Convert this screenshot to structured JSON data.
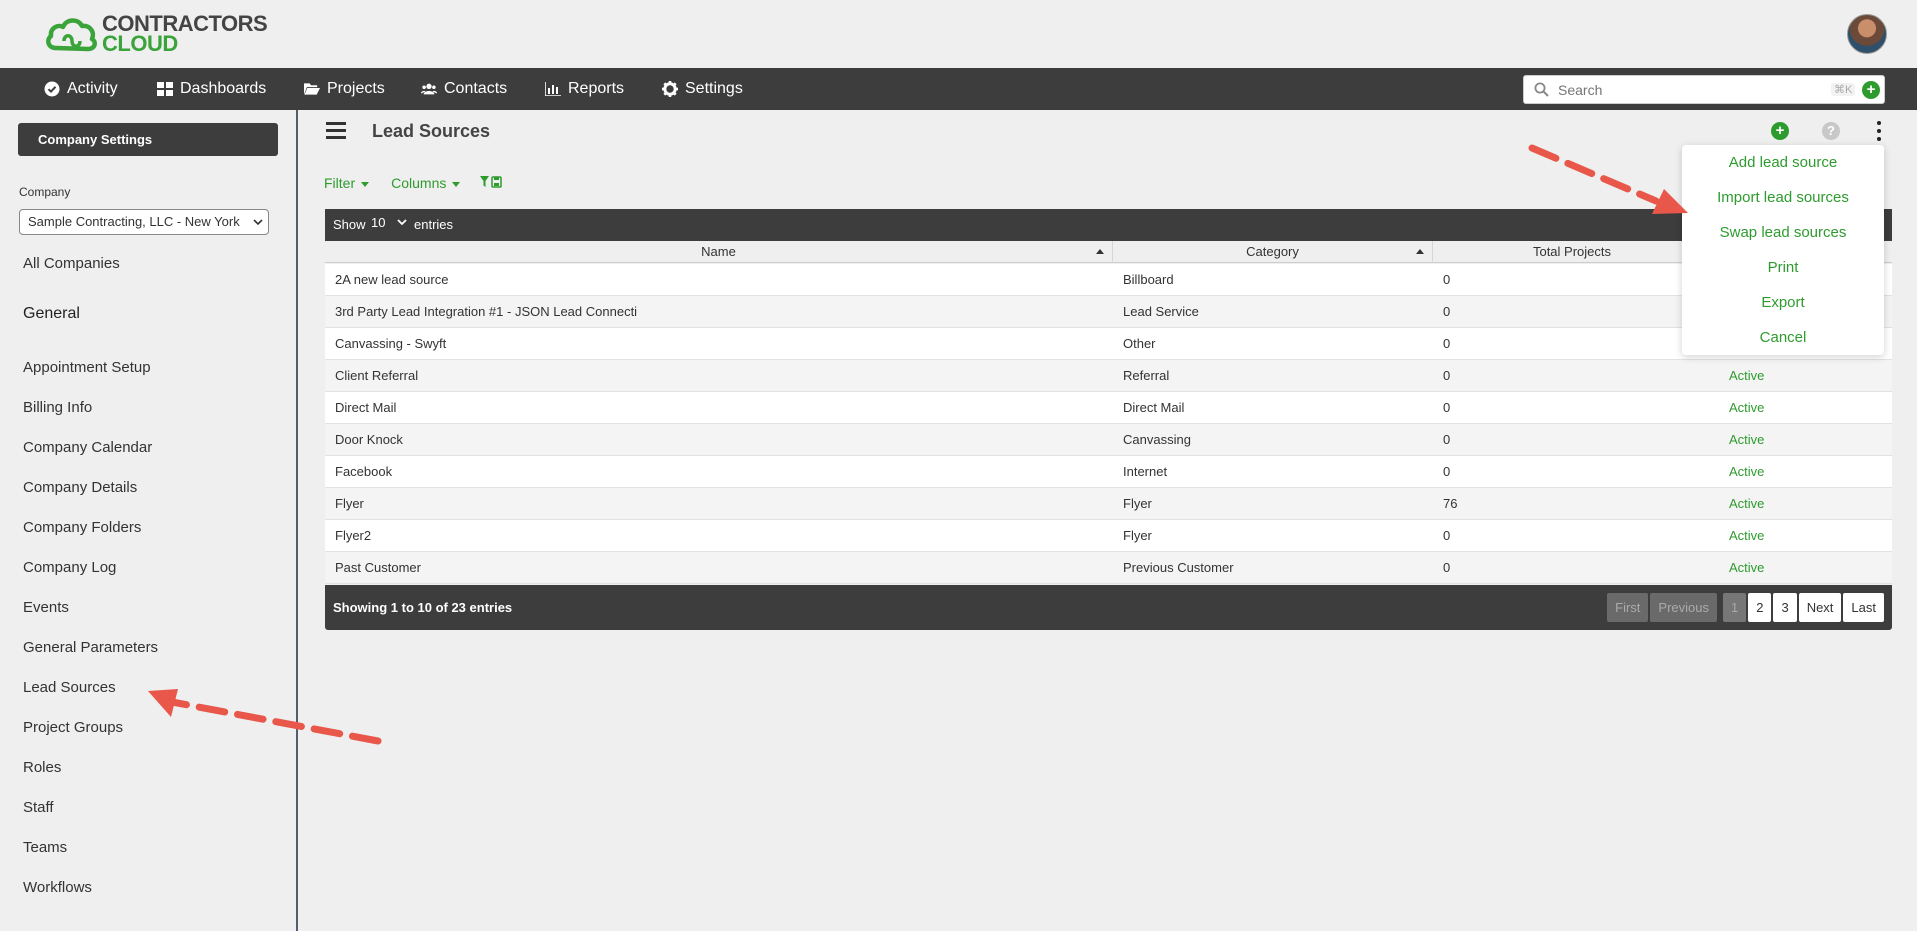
{
  "brand": {
    "line1": "CONTRACTORS",
    "line2": "CLOUD",
    "green": "#3aa33a",
    "dark": "#3d3d3d"
  },
  "nav": {
    "items": [
      {
        "label": "Activity",
        "icon": "check-circle-icon"
      },
      {
        "label": "Dashboards",
        "icon": "grid-icon"
      },
      {
        "label": "Projects",
        "icon": "folder-open-icon"
      },
      {
        "label": "Contacts",
        "icon": "users-icon"
      },
      {
        "label": "Reports",
        "icon": "bar-chart-icon"
      },
      {
        "label": "Settings",
        "icon": "gear-icon"
      }
    ],
    "search_placeholder": "Search",
    "search_shortcut": "⌘K"
  },
  "sidebar": {
    "settings_button": "Company Settings",
    "company_label": "Company",
    "company_value": "Sample Contracting, LLC - New York",
    "all_companies": "All Companies",
    "section_heading": "General",
    "links": [
      "Appointment Setup",
      "Billing Info",
      "Company Calendar",
      "Company Details",
      "Company Folders",
      "Company Log",
      "Events",
      "General Parameters",
      "Lead Sources",
      "Project Groups",
      "Roles",
      "Staff",
      "Teams",
      "Workflows"
    ]
  },
  "main": {
    "title": "Lead Sources",
    "filter_label": "Filter",
    "columns_label": "Columns",
    "show_label": "Show",
    "page_size": "10",
    "entries_label": "entries",
    "columns": [
      "Name",
      "Category",
      "Total Projects"
    ],
    "rows": [
      {
        "name": "2A new lead source",
        "category": "Billboard",
        "total": "0",
        "status": ""
      },
      {
        "name": "3rd Party Lead Integration #1 - JSON Lead Connecti",
        "category": "Lead Service",
        "total": "0",
        "status": ""
      },
      {
        "name": "Canvassing - Swyft",
        "category": "Other",
        "total": "0",
        "status": ""
      },
      {
        "name": "Client Referral",
        "category": "Referral",
        "total": "0",
        "status": "Active"
      },
      {
        "name": "Direct Mail",
        "category": "Direct Mail",
        "total": "0",
        "status": "Active"
      },
      {
        "name": "Door Knock",
        "category": "Canvassing",
        "total": "0",
        "status": "Active"
      },
      {
        "name": "Facebook",
        "category": "Internet",
        "total": "0",
        "status": "Active"
      },
      {
        "name": "Flyer",
        "category": "Flyer",
        "total": "76",
        "status": "Active"
      },
      {
        "name": "Flyer2",
        "category": "Flyer",
        "total": "0",
        "status": "Active"
      },
      {
        "name": "Past Customer",
        "category": "Previous Customer",
        "total": "0",
        "status": "Active"
      }
    ],
    "footer_info": "Showing 1 to 10 of 23 entries",
    "pager": {
      "first": "First",
      "previous": "Previous",
      "pages": [
        "1",
        "2",
        "3"
      ],
      "next": "Next",
      "last": "Last"
    }
  },
  "dropdown": {
    "items": [
      "Add lead source",
      "Import lead sources",
      "Swap lead sources",
      "Print",
      "Export",
      "Cancel"
    ]
  },
  "annotation_color": "#e8574a"
}
